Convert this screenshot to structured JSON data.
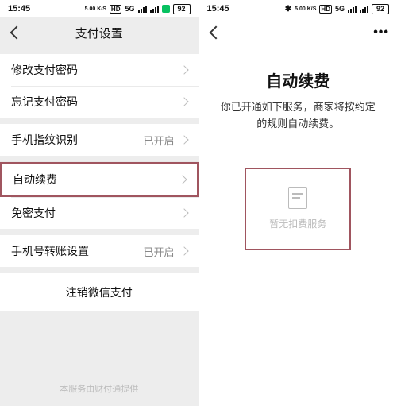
{
  "status": {
    "time": "15:45",
    "rate": "5.00\nK/S",
    "hd": "HD",
    "net": "5G",
    "battery": "92"
  },
  "left": {
    "title": "支付设置",
    "rows": [
      {
        "label": "修改支付密码",
        "value": ""
      },
      {
        "label": "忘记支付密码",
        "value": ""
      },
      {
        "label": "手机指纹识别",
        "value": "已开启"
      },
      {
        "label": "自动续费",
        "value": ""
      },
      {
        "label": "免密支付",
        "value": ""
      },
      {
        "label": "手机号转账设置",
        "value": "已开启"
      }
    ],
    "deregister": "注销微信支付",
    "footer": "本服务由财付通提供"
  },
  "right": {
    "title": "自动续费",
    "desc": "你已开通如下服务，商家将按约定的规则自动续费。",
    "empty": "暂无扣费服务"
  }
}
